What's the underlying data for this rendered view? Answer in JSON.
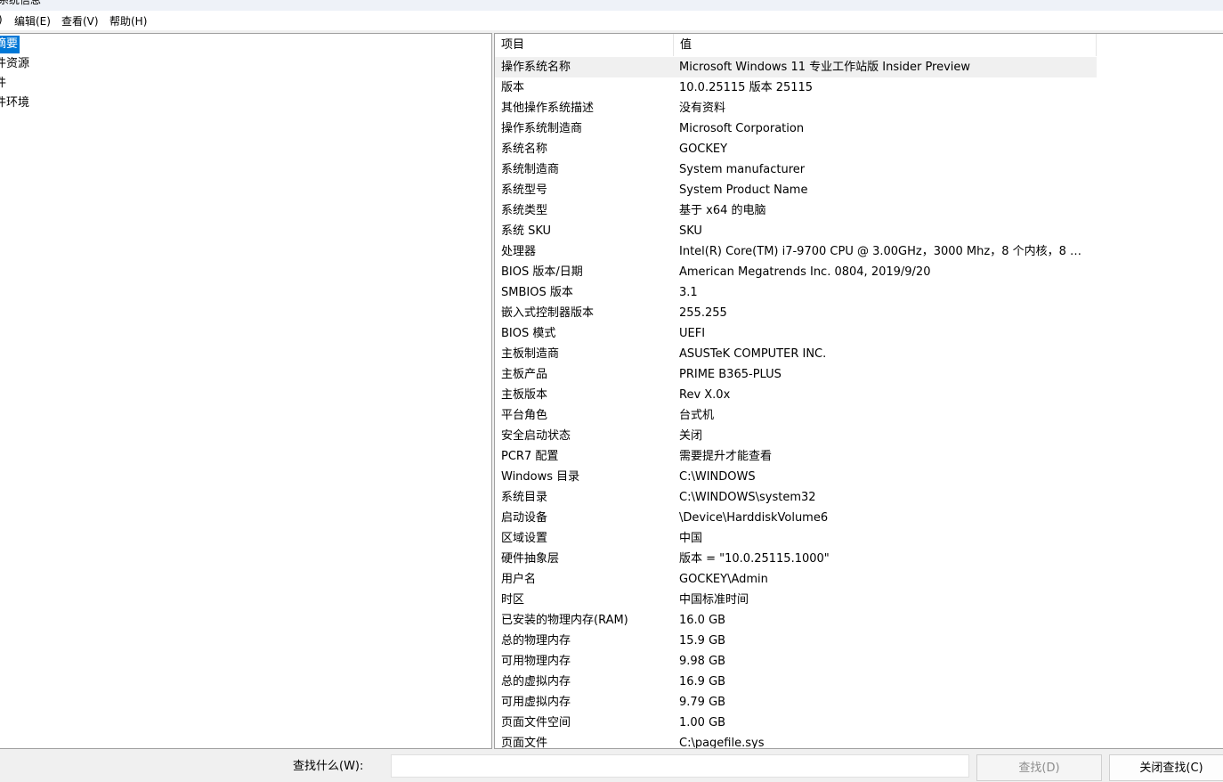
{
  "window": {
    "title": "系统信息"
  },
  "menu": [
    {
      "label": ")"
    },
    {
      "label": "编辑(E)"
    },
    {
      "label": "查看(V)"
    },
    {
      "label": "帮助(H)"
    }
  ],
  "tree": [
    {
      "label": "摘要",
      "selected": true
    },
    {
      "label": "件资源"
    },
    {
      "label": "件"
    },
    {
      "label": "件环境"
    }
  ],
  "table": {
    "headers": {
      "item": "项目",
      "value": "值"
    },
    "rows": [
      {
        "item": "操作系统名称",
        "value": "Microsoft Windows 11 专业工作站版 Insider Preview"
      },
      {
        "item": "版本",
        "value": "10.0.25115 版本 25115"
      },
      {
        "item": "其他操作系统描述",
        "value": "没有资料"
      },
      {
        "item": "操作系统制造商",
        "value": "Microsoft Corporation"
      },
      {
        "item": "系统名称",
        "value": "GOCKEY"
      },
      {
        "item": "系统制造商",
        "value": "System manufacturer"
      },
      {
        "item": "系统型号",
        "value": "System Product Name"
      },
      {
        "item": "系统类型",
        "value": "基于 x64 的电脑"
      },
      {
        "item": "系统 SKU",
        "value": "SKU"
      },
      {
        "item": "处理器",
        "value": "Intel(R) Core(TM) i7-9700 CPU @ 3.00GHz，3000 Mhz，8 个内核，8 个逻..."
      },
      {
        "item": "BIOS 版本/日期",
        "value": "American Megatrends Inc. 0804, 2019/9/20"
      },
      {
        "item": "SMBIOS 版本",
        "value": "3.1"
      },
      {
        "item": "嵌入式控制器版本",
        "value": "255.255"
      },
      {
        "item": "BIOS 模式",
        "value": "UEFI"
      },
      {
        "item": "主板制造商",
        "value": "ASUSTeK COMPUTER INC."
      },
      {
        "item": "主板产品",
        "value": "PRIME B365-PLUS"
      },
      {
        "item": "主板版本",
        "value": "Rev X.0x"
      },
      {
        "item": "平台角色",
        "value": "台式机"
      },
      {
        "item": "安全启动状态",
        "value": "关闭"
      },
      {
        "item": "PCR7 配置",
        "value": "需要提升才能查看"
      },
      {
        "item": "Windows 目录",
        "value": "C:\\WINDOWS"
      },
      {
        "item": "系统目录",
        "value": "C:\\WINDOWS\\system32"
      },
      {
        "item": "启动设备",
        "value": "\\Device\\HarddiskVolume6"
      },
      {
        "item": "区域设置",
        "value": "中国"
      },
      {
        "item": "硬件抽象层",
        "value": "版本 = \"10.0.25115.1000\""
      },
      {
        "item": "用户名",
        "value": "GOCKEY\\Admin"
      },
      {
        "item": "时区",
        "value": "中国标准时间"
      },
      {
        "item": "已安装的物理内存(RAM)",
        "value": "16.0 GB"
      },
      {
        "item": "总的物理内存",
        "value": "15.9 GB"
      },
      {
        "item": "可用物理内存",
        "value": "9.98 GB"
      },
      {
        "item": "总的虚拟内存",
        "value": "16.9 GB"
      },
      {
        "item": "可用虚拟内存",
        "value": "9.79 GB"
      },
      {
        "item": "页面文件空间",
        "value": "1.00 GB"
      },
      {
        "item": "页面文件",
        "value": "C:\\pagefile.sys"
      }
    ]
  },
  "find": {
    "label": "查找什么(W):",
    "value": "",
    "find_button": "查找(D)",
    "close_button": "关闭查找(C)"
  },
  "colors": {
    "selection": "#0078d7",
    "highlight_row": "#f0f0f0"
  }
}
